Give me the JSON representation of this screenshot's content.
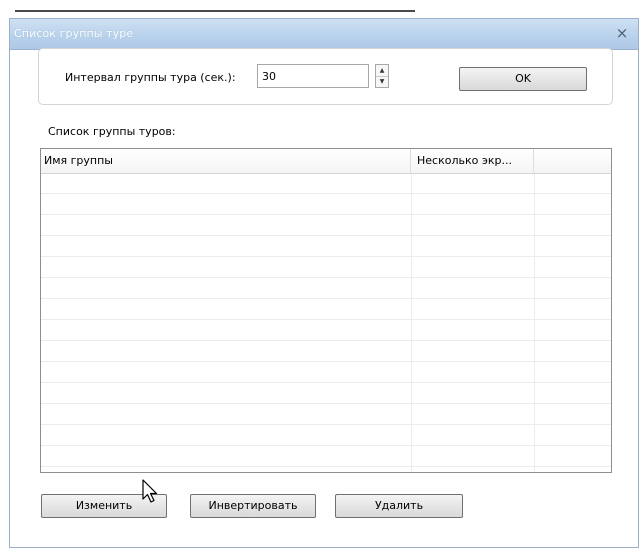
{
  "window": {
    "title": "Список группы туре",
    "close_glyph": "×"
  },
  "settings": {
    "interval_label": "Интервал группы тура (сек.):",
    "interval_value": "30",
    "ok_label": "OK"
  },
  "list": {
    "title": "Список группы туров:",
    "columns": [
      "Имя группы",
      "Несколько экр...",
      ""
    ],
    "row_count": 14
  },
  "buttons": {
    "edit_label": "Изменить",
    "invert_label": "Инвертировать",
    "delete_label": "Удалить"
  },
  "icons": {
    "close": "close-icon",
    "stepper_up": "chevron-up-icon",
    "stepper_down": "chevron-down-icon",
    "cursor": "mouse-pointer-icon"
  },
  "colors": {
    "titlebar": "#b9d2ec",
    "window_border": "#9ab0c7",
    "button_border": "#707070"
  }
}
